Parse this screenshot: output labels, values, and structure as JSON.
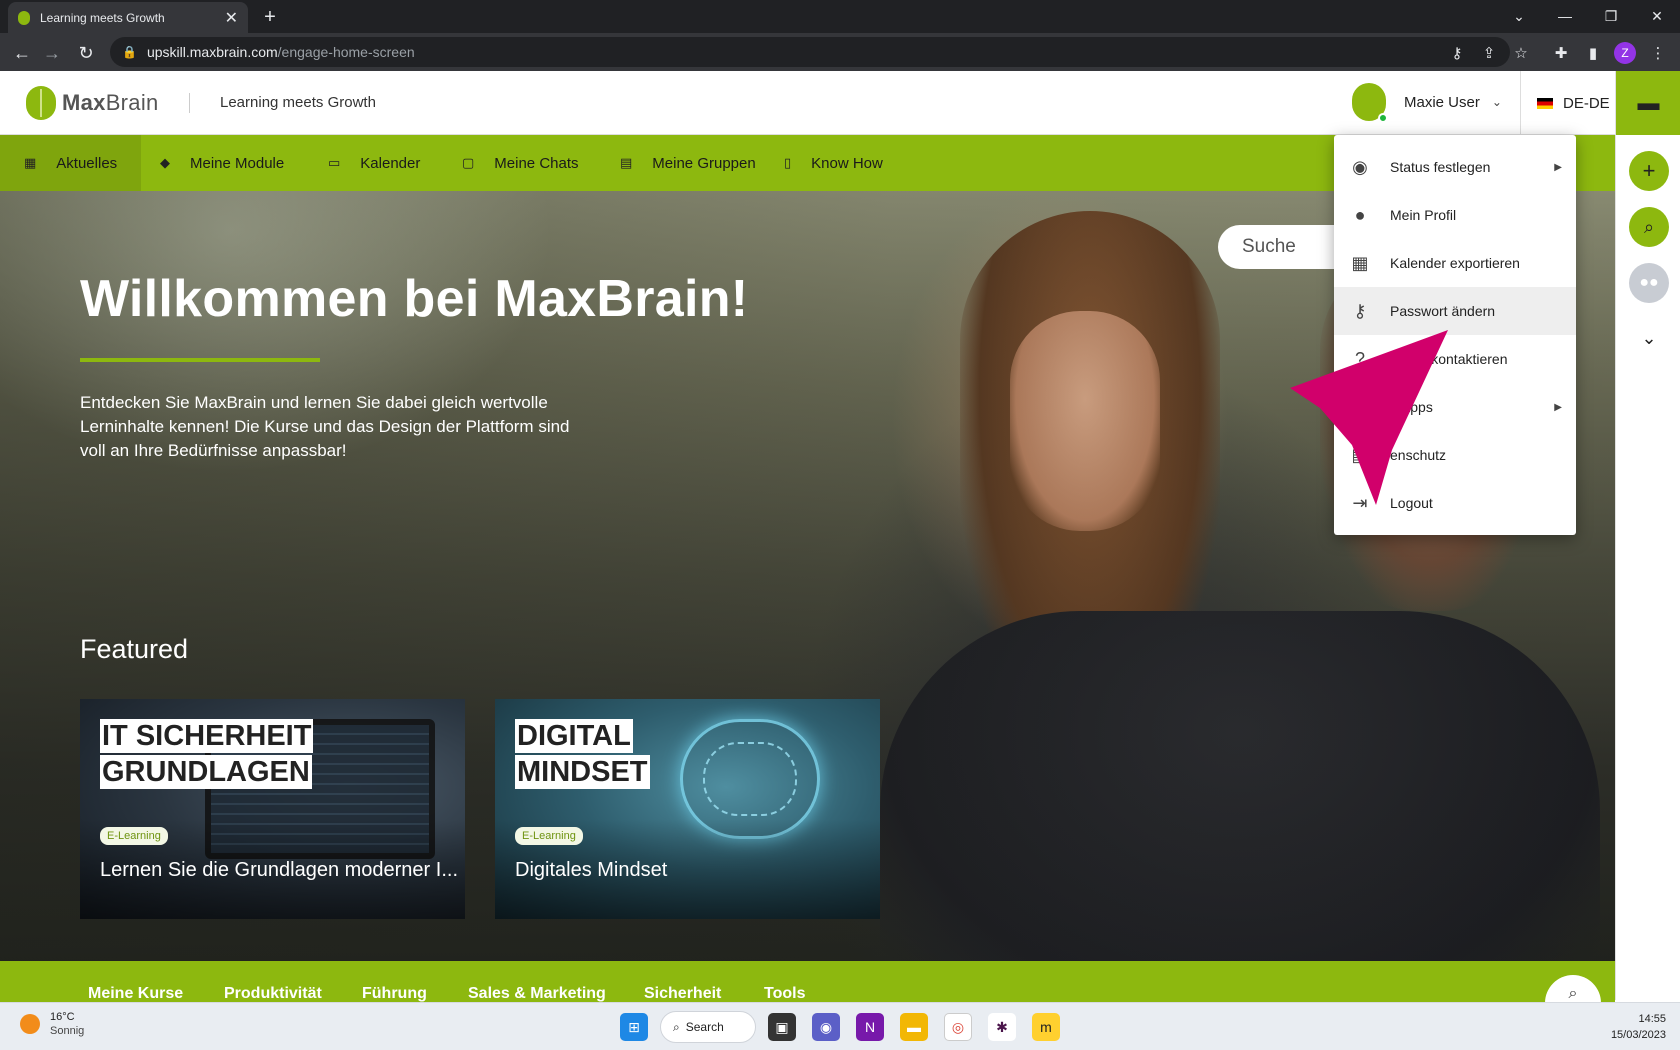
{
  "browser": {
    "tab_title": "Learning meets Growth",
    "url_domain": "upskill.maxbrain.com",
    "url_path": "/engage-home-screen",
    "profile_initial": "Z"
  },
  "header": {
    "logo_bold": "Max",
    "logo_rest": "Brain",
    "slogan": "Learning meets Growth",
    "user_name": "Maxie User",
    "language": "DE-DE"
  },
  "nav": {
    "items": [
      {
        "label": "Aktuelles",
        "icon": "dashboard-icon"
      },
      {
        "label": "Meine Module",
        "icon": "graduation-cap-icon"
      },
      {
        "label": "Kalender",
        "icon": "calendar-icon"
      },
      {
        "label": "Meine Chats",
        "icon": "chat-icon"
      },
      {
        "label": "Meine Gruppen",
        "icon": "group-icon"
      },
      {
        "label": "Know How",
        "icon": "book-icon"
      }
    ]
  },
  "hero": {
    "title": "Willkommen bei MaxBrain!",
    "intro": "Entdecken Sie MaxBrain und lernen Sie dabei gleich wertvolle Lerninhalte kennen! Die Kurse und das Design der Plattform sind voll an Ihre Bedürfnisse anpassbar!",
    "search_placeholder": "Suche",
    "featured_heading": "Featured"
  },
  "cards": [
    {
      "heading_line1": "IT SICHERHEIT",
      "heading_line2": "GRUNDLAGEN",
      "badge": "E-Learning",
      "title": "Lernen Sie die Grundlagen moderner I..."
    },
    {
      "heading_line1": "DIGITAL",
      "heading_line2": "MINDSET",
      "badge": "E-Learning",
      "title": "Digitales Mindset"
    }
  ],
  "user_menu": {
    "items": [
      {
        "label": "Status festlegen",
        "icon": "eye-icon",
        "submenu": true
      },
      {
        "label": "Mein Profil",
        "icon": "account-circle-icon",
        "submenu": false
      },
      {
        "label": "Kalender exportieren",
        "icon": "calendar-icon",
        "submenu": false
      },
      {
        "label": "Passwort ändern",
        "icon": "key-icon",
        "submenu": false
      },
      {
        "label": "ervice kontaktieren",
        "icon": "help-icon",
        "submenu": false
      },
      {
        "label": "e Apps",
        "icon": "mobile-icon",
        "submenu": true
      },
      {
        "label": "enschutz",
        "icon": "privacy-document-icon",
        "submenu": false
      },
      {
        "label": "Logout",
        "icon": "logout-icon",
        "submenu": false
      }
    ]
  },
  "categories": [
    "Meine Kurse",
    "Produktivität",
    "Führung",
    "Sales & Marketing",
    "Sicherheit",
    "Tools"
  ],
  "taskbar": {
    "temperature": "16°C",
    "weather": "Sonnig",
    "search_label": "Search",
    "time": "14:55",
    "date": "15/03/2023"
  },
  "colors": {
    "brand_green": "#8db80f",
    "pointer_magenta": "#d1006b"
  }
}
